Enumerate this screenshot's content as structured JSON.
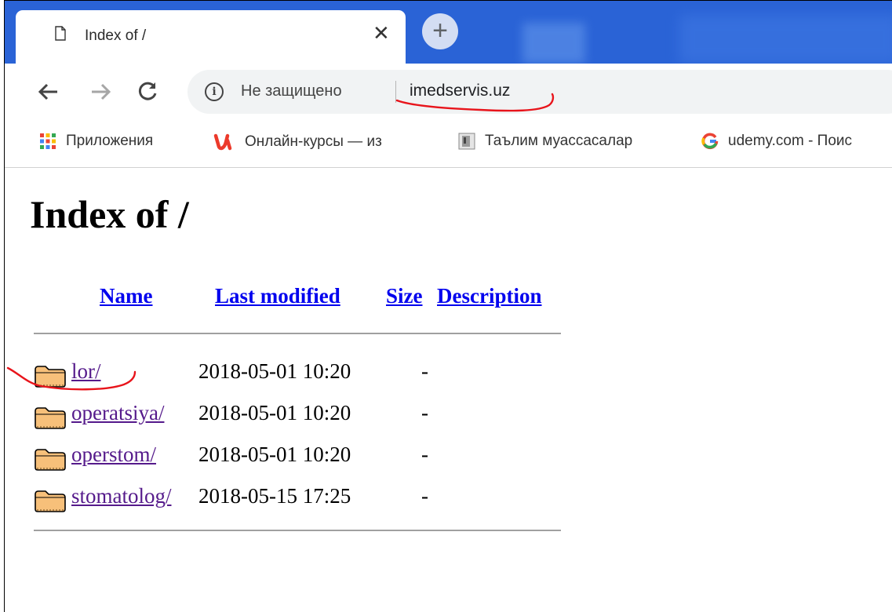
{
  "tab": {
    "title": "Index of /"
  },
  "toolbar": {
    "security_text": "Не защищено",
    "url": "imedservis.uz"
  },
  "bookmarks": [
    {
      "label": "Приложения",
      "icon": "apps-grid-icon"
    },
    {
      "label": "Онлайн-курсы — из",
      "icon": "udemy-logo-icon"
    },
    {
      "label": "Таълим муассасалар",
      "icon": "page-thumb-icon"
    },
    {
      "label": "udemy.com - Поис",
      "icon": "google-g-icon"
    }
  ],
  "page": {
    "heading": "Index of /",
    "columns": {
      "name": "Name",
      "last_modified": "Last modified",
      "size": "Size",
      "description": "Description"
    },
    "rows": [
      {
        "name": "lor/",
        "modified": "2018-05-01 10:20",
        "size": "-"
      },
      {
        "name": "operatsiya/",
        "modified": "2018-05-01 10:20",
        "size": "-"
      },
      {
        "name": "operstom/",
        "modified": "2018-05-01 10:20",
        "size": "-"
      },
      {
        "name": "stomatolog/",
        "modified": "2018-05-15 17:25",
        "size": "-"
      }
    ]
  },
  "colors": {
    "tabstrip": "#2a63d6",
    "link": "#0000ee",
    "visited_link": "#551a8b",
    "annotation": "#e8141b",
    "folder_fill": "#f7c07a"
  }
}
